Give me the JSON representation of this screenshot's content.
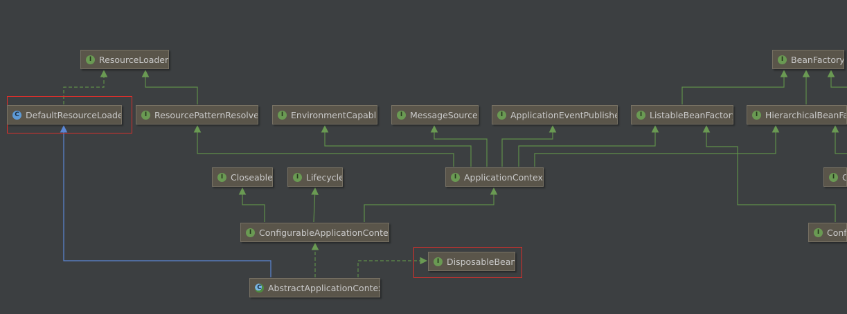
{
  "nodes": {
    "resource_loader": {
      "label": "ResourceLoader",
      "kind": "interface",
      "badge": "I"
    },
    "default_resource_loader": {
      "label": "DefaultResourceLoader",
      "kind": "class",
      "badge": "C"
    },
    "resource_pattern_resolver": {
      "label": "ResourcePatternResolver",
      "kind": "interface",
      "badge": "I"
    },
    "environment_capable": {
      "label": "EnvironmentCapable",
      "kind": "interface",
      "badge": "I"
    },
    "message_source": {
      "label": "MessageSource",
      "kind": "interface",
      "badge": "I"
    },
    "application_event_publisher": {
      "label": "ApplicationEventPublisher",
      "kind": "interface",
      "badge": "I"
    },
    "listable_bean_factory": {
      "label": "ListableBeanFactory",
      "kind": "interface",
      "badge": "I"
    },
    "hierarchical_bean_factory": {
      "label": "HierarchicalBeanFactory",
      "kind": "interface",
      "badge": "I"
    },
    "bean_factory": {
      "label": "BeanFactory",
      "kind": "interface",
      "badge": "I"
    },
    "closeable": {
      "label": "Closeable",
      "kind": "interface",
      "badge": "I"
    },
    "lifecycle": {
      "label": "Lifecycle",
      "kind": "interface",
      "badge": "I"
    },
    "application_context": {
      "label": "ApplicationContext",
      "kind": "interface",
      "badge": "I"
    },
    "configurable_application_context": {
      "label": "ConfigurableApplicationContext",
      "kind": "interface",
      "badge": "I"
    },
    "disposable_bean": {
      "label": "DisposableBean",
      "kind": "interface",
      "badge": "I"
    },
    "abstract_application_context": {
      "label": "AbstractApplicationContext",
      "kind": "abstract-class",
      "badge": "C"
    },
    "partial_c": {
      "label": "C",
      "kind": "interface",
      "badge": "I"
    },
    "partial_config": {
      "label": "Config",
      "kind": "interface",
      "badge": "I"
    }
  },
  "colors": {
    "background": "#3c3f41",
    "node_fill": "#5a554a",
    "node_border": "#777163",
    "node_text": "#c9c9c9",
    "extends_edge": "#5f8f4a",
    "class_extends_edge": "#5b87d6",
    "highlight": "#d9302c"
  },
  "edges": [
    {
      "from": "default_resource_loader",
      "to": "resource_loader",
      "style": "dashed"
    },
    {
      "from": "resource_pattern_resolver",
      "to": "resource_loader",
      "style": "solid"
    },
    {
      "from": "application_context",
      "to": "resource_pattern_resolver",
      "style": "solid"
    },
    {
      "from": "application_context",
      "to": "environment_capable",
      "style": "solid"
    },
    {
      "from": "application_context",
      "to": "message_source",
      "style": "solid"
    },
    {
      "from": "application_context",
      "to": "application_event_publisher",
      "style": "solid"
    },
    {
      "from": "application_context",
      "to": "listable_bean_factory",
      "style": "solid"
    },
    {
      "from": "application_context",
      "to": "hierarchical_bean_factory",
      "style": "solid"
    },
    {
      "from": "listable_bean_factory",
      "to": "bean_factory",
      "style": "solid"
    },
    {
      "from": "hierarchical_bean_factory",
      "to": "bean_factory",
      "style": "solid"
    },
    {
      "from": "configurable_application_context",
      "to": "closeable",
      "style": "solid"
    },
    {
      "from": "configurable_application_context",
      "to": "lifecycle",
      "style": "solid"
    },
    {
      "from": "configurable_application_context",
      "to": "application_context",
      "style": "solid"
    },
    {
      "from": "abstract_application_context",
      "to": "configurable_application_context",
      "style": "dashed"
    },
    {
      "from": "abstract_application_context",
      "to": "disposable_bean",
      "style": "dashed"
    },
    {
      "from": "abstract_application_context",
      "to": "default_resource_loader",
      "style": "solid-class"
    },
    {
      "from": "partial_config",
      "to": "listable_bean_factory",
      "style": "solid"
    }
  ],
  "highlighted": [
    "default_resource_loader",
    "disposable_bean"
  ]
}
